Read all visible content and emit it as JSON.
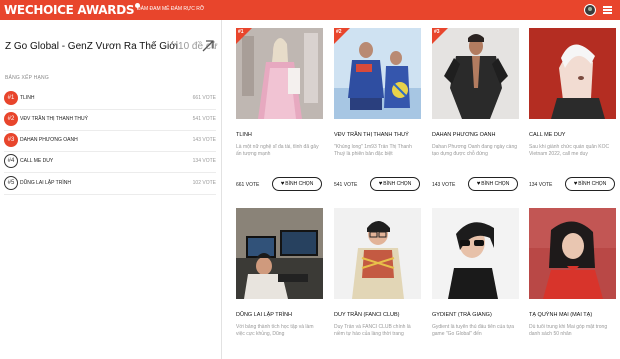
{
  "header": {
    "logo": "WECHOICE AWARDS",
    "tagline": "ĐÁM ĐAM MÊ ĐÁM RỰC RỠ",
    "avatar_label": "user avatar"
  },
  "category": {
    "title": "Z Go Global - GenZ Vươn Ra Thế Giới",
    "count": "10 đề cử"
  },
  "ranking": {
    "label": "BẢNG XẾP HẠNG",
    "items": [
      {
        "rank": "#1",
        "name": "TLINH",
        "votes": "661 VOTE",
        "style": "filled"
      },
      {
        "rank": "#2",
        "name": "VĐV TRẦN THỊ THANH THUÝ",
        "votes": "541 VOTE",
        "style": "filled"
      },
      {
        "rank": "#3",
        "name": "DAHAN PHƯƠNG OANH",
        "votes": "143 VOTE",
        "style": "filled"
      },
      {
        "rank": "#4",
        "name": "CALL ME DUY",
        "votes": "134 VOTE",
        "style": "outline"
      },
      {
        "rank": "#5",
        "name": "DŨNG LAI LẬP TRÌNH",
        "votes": "102 VOTE",
        "style": "outline"
      }
    ]
  },
  "vote_button_label": "BÌNH CHỌN",
  "nominees": [
    {
      "badge": "#1",
      "name": "TLINH",
      "desc": "Là một nữ nghệ sĩ đa tài, tlinh đã gây ấn tượng mạnh",
      "votes": "661 VOTE"
    },
    {
      "badge": "#2",
      "name": "VĐV TRẦN THỊ THANH THUÝ",
      "desc": "\"Khủng long\" 1m93 Trần Thị Thanh Thuý là phiên bản đặc biệt",
      "votes": "541 VOTE"
    },
    {
      "badge": "#3",
      "name": "DAHAN PHƯƠNG OANH",
      "desc": "Dahan Phương Oanh đang ngày càng tạo dựng được chỗ đứng",
      "votes": "143 VOTE"
    },
    {
      "badge": "",
      "name": "CALL ME DUY",
      "desc": "Sau khi giành chức quán quân KOC Vietnam 2022, call me duy",
      "votes": "134 VOTE"
    },
    {
      "badge": "",
      "name": "DŨNG LAI LẬP TRÌNH",
      "desc": "Với bảng thành tích học tập và làm việc cực khủng, Dũng",
      "votes": ""
    },
    {
      "badge": "",
      "name": "DUY TRẦN (FANCI CLUB)",
      "desc": "Duy Trần và FANCI CLUB chính là niềm tự hào của làng thời trang",
      "votes": ""
    },
    {
      "badge": "",
      "name": "GYDIENT (TRÀ GIANG)",
      "desc": "Gydient là tuyển thủ đầu tiên của tựa game \"Go Global\" đến",
      "votes": ""
    },
    {
      "badge": "",
      "name": "TẠ QUỲNH MAI (MAI TẠ)",
      "desc": "Dù tuổi trung khi Mai góp mặt trong danh sách 50 nhân",
      "votes": ""
    }
  ],
  "colors": {
    "brand": "#e8452c",
    "divider": "#e2e2e2",
    "muted_text": "#999999"
  }
}
